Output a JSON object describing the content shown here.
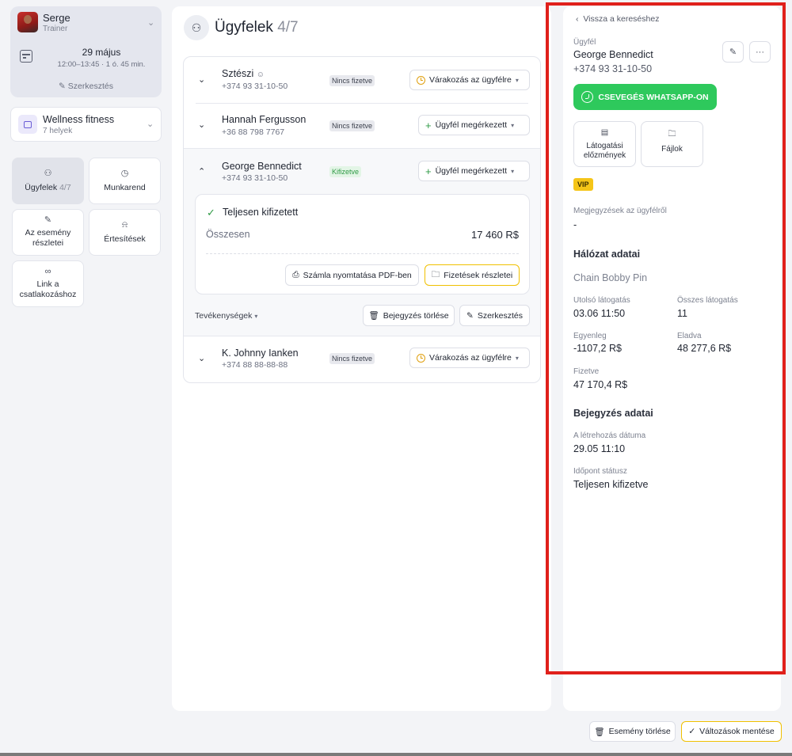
{
  "trainer": {
    "name": "Serge",
    "role": "Trainer",
    "date": "29 május",
    "time": "12:00–13:45 · 1 ó. 45 min.",
    "edit_label": "Szerkesztés"
  },
  "venue": {
    "name": "Wellness fitness",
    "sub": "7 helyek"
  },
  "nav": {
    "clients": {
      "label": "Ügyfelek",
      "count": "4/7"
    },
    "schedule": "Munkarend",
    "event_details": "Az esemény részletei",
    "notifications": "Értesítések",
    "join_link": "Link a csatlakozáshoz"
  },
  "page": {
    "title": "Ügyfelek",
    "count": "4/7"
  },
  "clients": [
    {
      "name": "Sztészi",
      "phone": "+374 93 31-10-50",
      "badge": "Nincs fizetve",
      "status": "Várakozás az ügyfélre"
    },
    {
      "name": "Hannah Fergusson",
      "phone": "+36 88 798 7767",
      "badge": "Nincs fizetve",
      "status": "Ügyfél megérkezett"
    },
    {
      "name": "George Bennedict",
      "phone": "+374 93 31-10-50",
      "badge": "Kifizetve",
      "status": "Ügyfél megérkezett"
    },
    {
      "name": "K. Johnny Ianken",
      "phone": "+374 88 88-88-88",
      "badge": "Nincs fizetve",
      "status": "Várakozás az ügyfélre"
    }
  ],
  "payment": {
    "title": "Teljesen kifizetett",
    "total_label": "Összesen",
    "total_value": "17 460 R$",
    "print_label": "Számla nyomtatása PDF-ben",
    "details_label": "Fizetések részletei"
  },
  "activities": {
    "label": "Tevékenységek",
    "delete_label": "Bejegyzés törlése",
    "edit_label": "Szerkesztés"
  },
  "detail": {
    "back_label": "Vissza a kereséshez",
    "client_label": "Ügyfél",
    "client_name": "George Bennedict",
    "client_phone": "+374 93 31-10-50",
    "whatsapp_label": "CSEVEGÉS WHATSAPP-ON",
    "tile_history": "Látogatási előzmények",
    "tile_files": "Fájlok",
    "vip": "VIP",
    "notes_label": "Megjegyzések az ügyfélről",
    "notes_value": "-",
    "network_title": "Hálózat adatai",
    "network_name": "Chain Bobby Pin",
    "last_visit_label": "Utolsó látogatás",
    "last_visit_value": "03.06 11:50",
    "total_visits_label": "Összes látogatás",
    "total_visits_value": "11",
    "balance_label": "Egyenleg",
    "balance_value": "-1107,2 R$",
    "sold_label": "Eladva",
    "sold_value": "48 277,6 R$",
    "paid_label": "Fizetve",
    "paid_value": "47 170,4 R$",
    "entry_title": "Bejegyzés adatai",
    "created_label": "A létrehozás dátuma",
    "created_value": "29.05 11:10",
    "status_label": "Időpont státusz",
    "status_value": "Teljesen kifizetve"
  },
  "footer": {
    "delete_event": "Esemény törlése",
    "save_changes": "Változások mentése"
  },
  "colors": {
    "accent_yellow": "#f0c000",
    "whatsapp_green": "#2ec95c",
    "paid_green": "#2f9a45",
    "highlight_red": "#e0201b"
  }
}
